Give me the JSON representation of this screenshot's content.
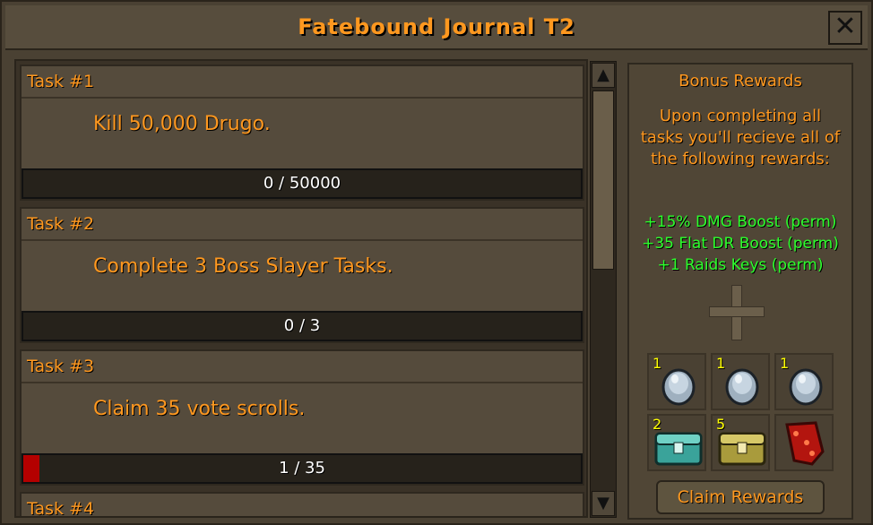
{
  "window": {
    "title": "Fatebound Journal T2",
    "close_symbol": "✕"
  },
  "tasks": [
    {
      "header": "Task #1",
      "description": "Kill 50,000 Drugo.",
      "progress_text": "0 / 50000",
      "progress": 0
    },
    {
      "header": "Task #2",
      "description": "Complete 3 Boss Slayer Tasks.",
      "progress_text": "0 / 3",
      "progress": 0
    },
    {
      "header": "Task #3",
      "description": "Claim 35 vote scrolls.",
      "progress_text": "1 / 35",
      "progress": 0.0286
    },
    {
      "header": "Task #4"
    }
  ],
  "scrollbar": {
    "up_symbol": "▲",
    "down_symbol": "▼"
  },
  "rewards": {
    "title": "Bonus Rewards",
    "description": "Upon completing all tasks you'll recieve all of the following rewards:",
    "perms": [
      "+15% DMG Boost (perm)",
      "+35 Flat DR Boost (perm)",
      "+1 Raids Keys (perm)"
    ],
    "items": [
      {
        "count": "1",
        "icon": "grey-gem-icon"
      },
      {
        "count": "1",
        "icon": "grey-gem-icon"
      },
      {
        "count": "1",
        "icon": "grey-gem-icon"
      },
      {
        "count": "2",
        "icon": "teal-chest-icon"
      },
      {
        "count": "5",
        "icon": "gold-chest-icon"
      },
      {
        "count": "",
        "icon": "red-scroll-icon"
      }
    ],
    "claim_label": "Claim Rewards"
  },
  "colors": {
    "orange_text": "#ff981f",
    "green_text": "#2cff2c",
    "progress_red": "#b40000"
  }
}
